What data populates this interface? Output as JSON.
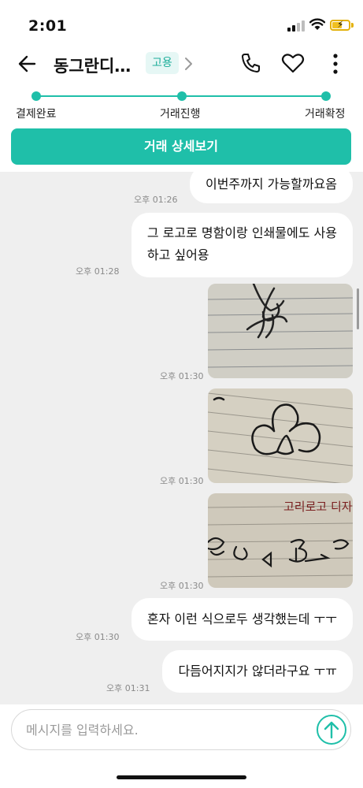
{
  "status_bar": {
    "time": "2:01"
  },
  "header": {
    "title": "동그란디…",
    "badge": "고용"
  },
  "progress": {
    "steps": [
      {
        "label": "결제완료"
      },
      {
        "label": "거래진행"
      },
      {
        "label": "거래확정"
      }
    ],
    "accent_color": "#1fbfa9"
  },
  "detail_button": {
    "label": "거래 상세보기"
  },
  "messages": [
    {
      "type": "text",
      "text": "이번주까지 가능할까요옴",
      "time": "오후 01:26"
    },
    {
      "type": "text",
      "lines": [
        "그 로고로 명함이랑 인쇄물에도 사용",
        "하고 싶어용"
      ],
      "time": "오후 01:28"
    },
    {
      "type": "image",
      "time": "오후 01:30"
    },
    {
      "type": "image",
      "time": "오후 01:30"
    },
    {
      "type": "image",
      "time": "오후 01:30",
      "handwriting": "고리로고 디자인"
    },
    {
      "type": "text",
      "text": "혼자 이런 식으로두 생각했는데 ㅜㅜ",
      "time": "오후 01:30"
    },
    {
      "type": "text",
      "text": "다듬어지지가 않더라구요 ㅜㅠ",
      "time": "오후 01:31"
    }
  ],
  "input": {
    "placeholder": "메시지를 입력하세요.",
    "value": ""
  }
}
